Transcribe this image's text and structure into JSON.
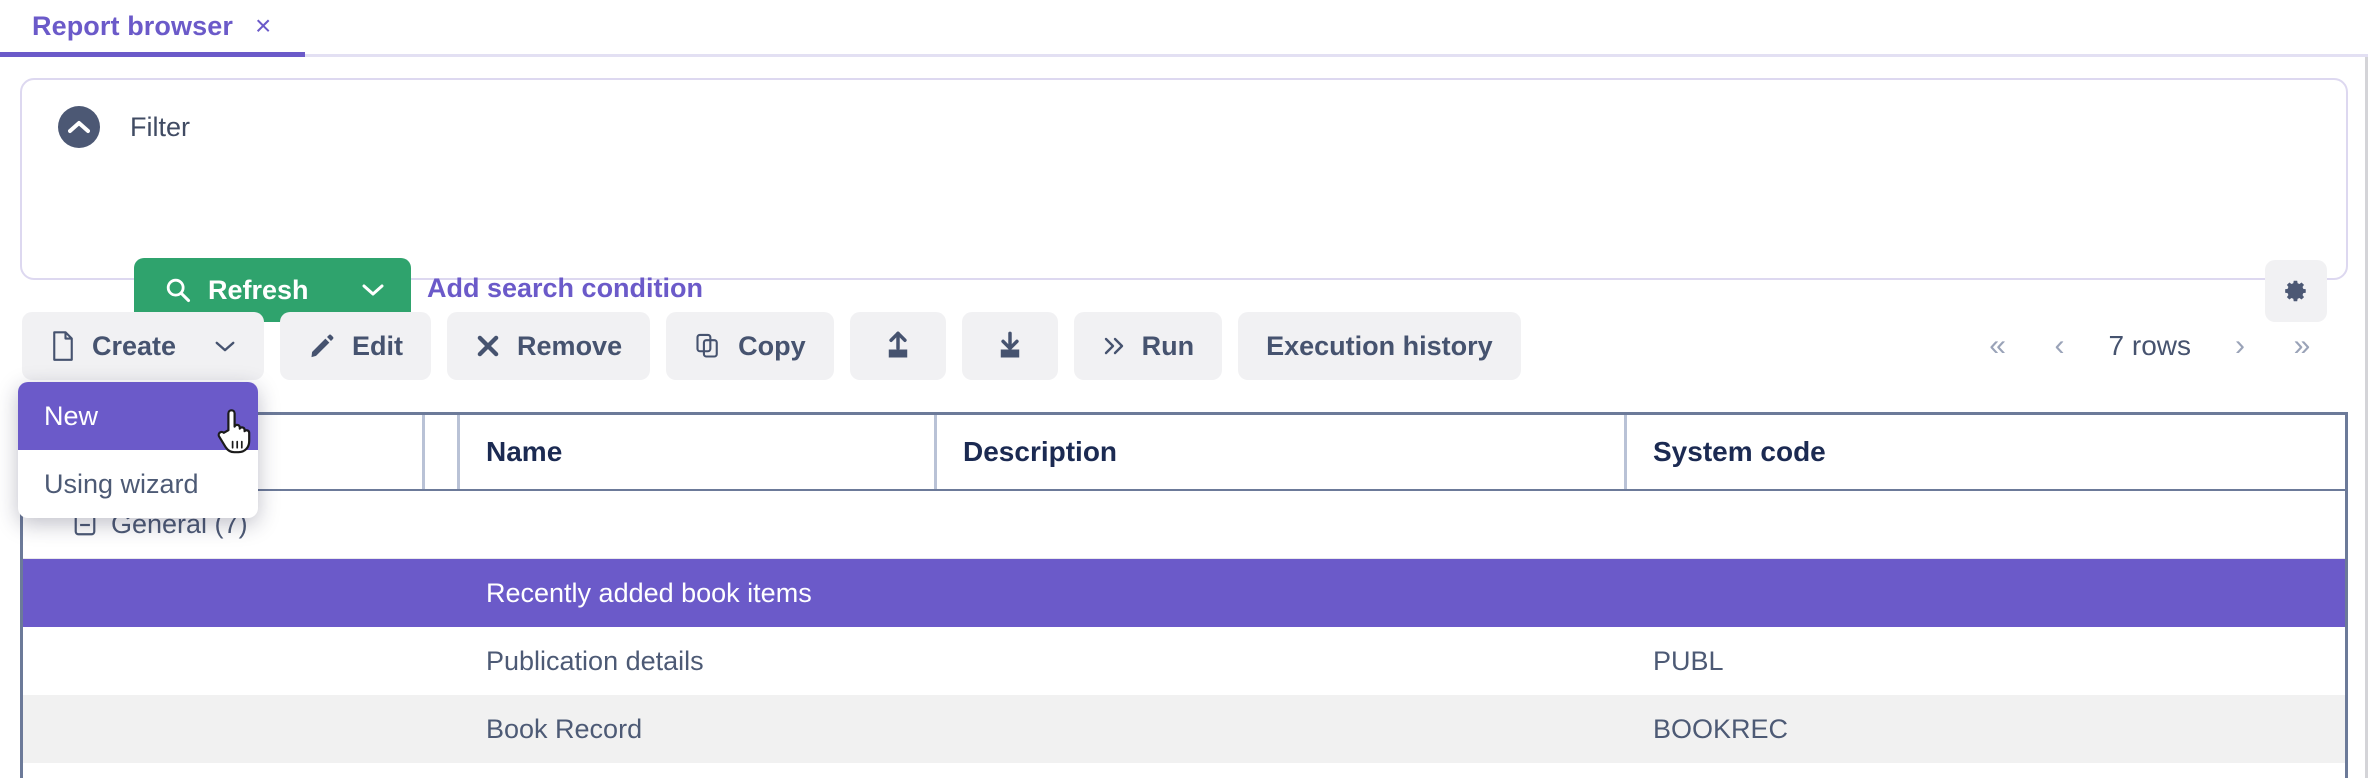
{
  "tab": {
    "label": "Report browser",
    "close_icon": "close-icon",
    "close_glyph": "×"
  },
  "filter": {
    "title": "Filter",
    "collapse_icon": "chevron-up-circle-icon",
    "refresh_label": "Refresh",
    "refresh_icon": "search-icon",
    "refresh_caret_icon": "chevron-down-icon",
    "refresh_color": "#2fa36d",
    "add_condition_label": "Add search condition",
    "add_condition_color": "#6b5ac9",
    "settings_icon": "gear-icon"
  },
  "toolbar": {
    "buttons": [
      {
        "label": "Create",
        "icon": "file-icon",
        "caret": true
      },
      {
        "label": "Edit",
        "icon": "pencil-icon",
        "caret": false
      },
      {
        "label": "Remove",
        "icon": "cross-icon",
        "caret": false
      },
      {
        "label": "Copy",
        "icon": "copy-icon",
        "caret": false
      },
      {
        "label": "",
        "icon": "upload-icon",
        "caret": false
      },
      {
        "label": "",
        "icon": "download-icon",
        "caret": false
      },
      {
        "label": "Run",
        "icon": "double-chevron-right-icon",
        "caret": false
      },
      {
        "label": "Execution history",
        "icon": "",
        "caret": false
      }
    ]
  },
  "pagination": {
    "first_glyph": "«",
    "prev_glyph": "‹",
    "rows_label": "7 rows",
    "next_glyph": "›",
    "last_glyph": "»"
  },
  "create_menu": {
    "items": [
      {
        "label": "New",
        "active": true
      },
      {
        "label": "Using wizard",
        "active": false
      }
    ],
    "highlight_color": "#6b5ac9"
  },
  "grid": {
    "columns": [
      {
        "label": "",
        "key": "sel"
      },
      {
        "label": "",
        "key": "icon"
      },
      {
        "label": "Name",
        "key": "name"
      },
      {
        "label": "Description",
        "key": "description"
      },
      {
        "label": "System code",
        "key": "system_code"
      }
    ],
    "group": {
      "toggle_icon": "minus-box-icon",
      "label": "General (7)"
    },
    "rows": [
      {
        "name": "Recently added book items",
        "description": "",
        "system_code": "",
        "selected": true
      },
      {
        "name": "Publication details",
        "description": "",
        "system_code": "PUBL",
        "selected": false
      },
      {
        "name": "Book Record",
        "description": "",
        "system_code": "BOOKREC",
        "selected": false
      }
    ],
    "selected_row_color": "#6b5ac9"
  }
}
